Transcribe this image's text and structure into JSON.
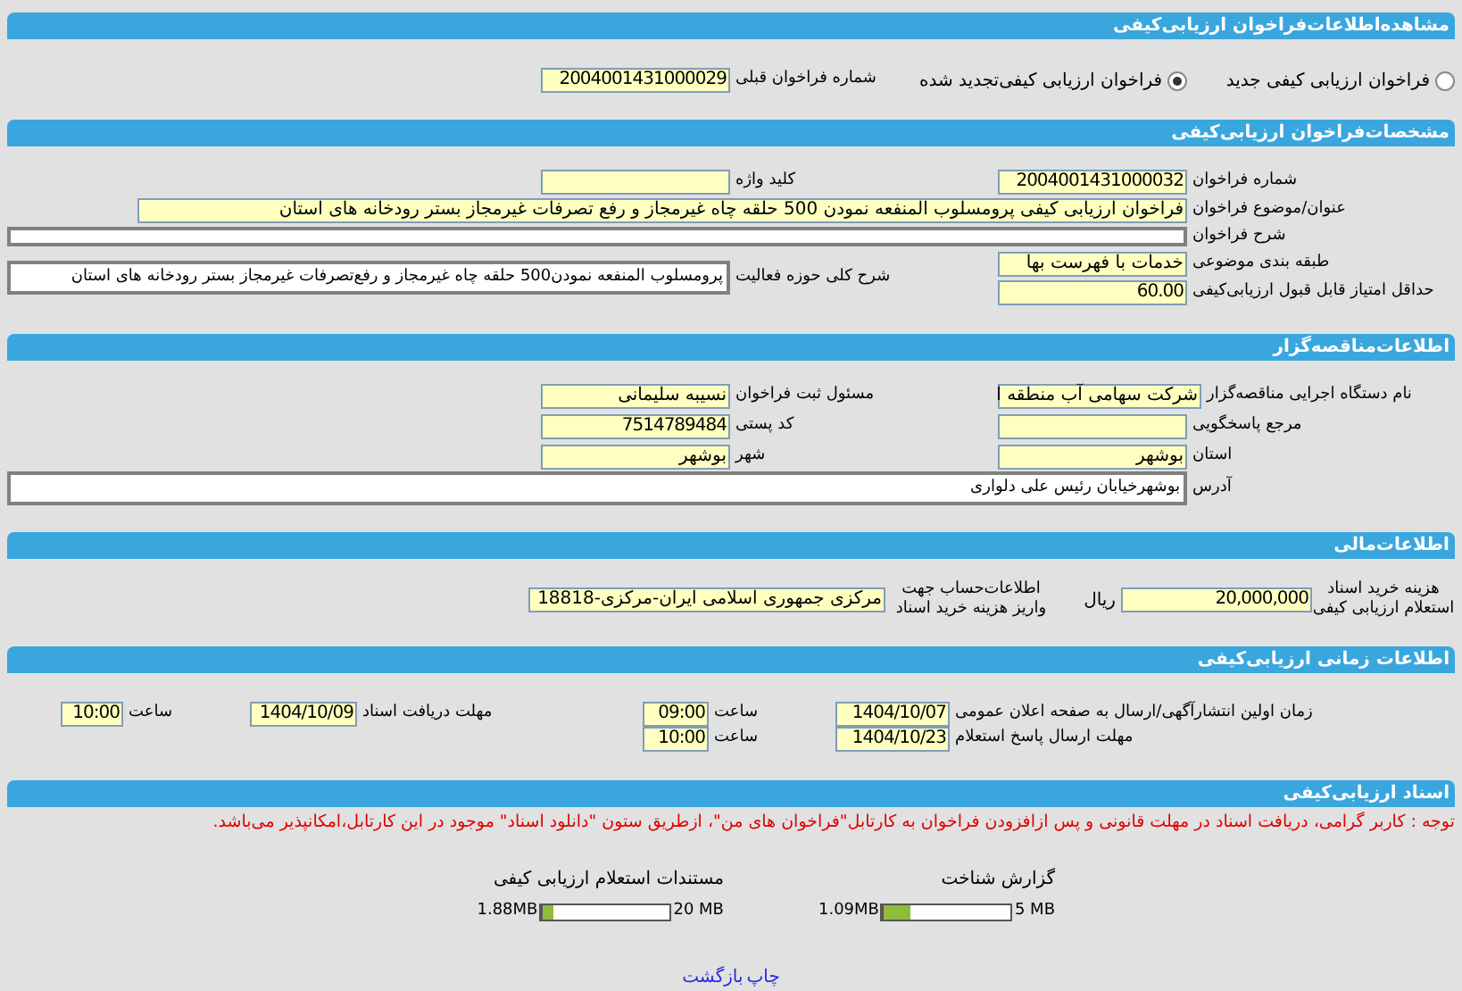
{
  "page_title": "مشاهده‌اطلاعات‌فراخوان ارزیابی‌کیفی",
  "call_type": {
    "options": [
      {
        "label": "فراخوان ارزیابی کیفی جدید",
        "selected": false
      },
      {
        "label": "فراخوان ارزیابی کیفی‌تجدید شده",
        "selected": true
      }
    ],
    "previous_number": {
      "label": "شماره فراخوان قبلی",
      "value": "2004001431000029"
    }
  },
  "specs": {
    "title": "مشخصات‌فراخوان ارزیابی‌کیفی",
    "number": {
      "label": "شماره فراخوان",
      "value": "2004001431000032"
    },
    "keyword": {
      "label": "کلید واژه"
    },
    "subject": {
      "label": "عنوان/موضوع فراخوان",
      "value": "فراخوان ارزیابی کیفی پرومسلوب المنفعه نمودن 500 حلقه چاه غیرمجاز و رفع تصرفات غیرمجاز بستر رودخانه های استان"
    },
    "description": {
      "label": "شرح فراخوان"
    },
    "category": {
      "label": "طبقه بندی موضوعی",
      "value": "خدمات با فهرست بها"
    },
    "min_score": {
      "label": "حداقل امتیاز قابل قبول ارزیابی‌کیفی",
      "value": "60.00"
    },
    "activity": {
      "label": "شرح کلی حوزه فعالیت",
      "value": "پرومسلوب المنفعه نمودن500 حلقه چاه غیرمجاز و رفع‌تصرفات غیرمجاز بستر رودخانه های استان"
    }
  },
  "organizer": {
    "title": "اطلاعات‌مناقصه‌گزار",
    "organization": {
      "label": "نام دستگاه اجرایی مناقصه‌گزار",
      "value": "شرکت سهامی آب منطقه ا"
    },
    "registrar": {
      "label": "مسئول ثبت فراخوان",
      "value": "نسیبه سلیمانی"
    },
    "responder": {
      "label": "مرجع پاسخگویی"
    },
    "postal_code": {
      "label": "کد پستی",
      "value": "7514789484"
    },
    "province": {
      "label": "استان",
      "value": "بوشهر"
    },
    "city": {
      "label": "شهر",
      "value": "بوشهر"
    },
    "address": {
      "label": "آدرس",
      "value": "بوشهرخیابان رئیس علی دلواری"
    }
  },
  "financial": {
    "title": "اطلاعات‌مالی",
    "fee": {
      "label_lines": [
        "هزینه خرید اسناد",
        "استعلام ارزیابی کیفی"
      ],
      "value": "20,000,000",
      "unit": "ریال"
    },
    "account": {
      "label_lines": [
        "اطلاعات‌حساب جهت",
        "واریز هزینه خرید اسناد"
      ],
      "value": "مرکزی جمهوری اسلامی ایران-مرکزی-18818"
    }
  },
  "timing": {
    "title": "اطلاعات زمانی ارزیابی‌کیفی",
    "rows": [
      {
        "label": "زمان اولین انتشارآگهی/ارسال به صفحه اعلان عمومی",
        "date": "1404/10/07",
        "time_label": "ساعت",
        "time": "09:00",
        "second": {
          "label": "مهلت دریافت اسناد",
          "date": "1404/10/09",
          "time_label": "ساعت",
          "time": "10:00"
        }
      },
      {
        "label": "مهلت ارسال پاسخ استعلام",
        "date": "1404/10/23",
        "time_label": "ساعت",
        "time": "10:00"
      }
    ]
  },
  "documents": {
    "title": "اسناد ارزیابی‌کیفی",
    "note": "توجه : کاربر گرامی، دریافت اسناد در مهلت قانونی و پس ازافزودن فراخوان به کارتابل\"فراخوان های من\"، ازطریق ستون \"دانلود اسناد\" موجود در این کارتابل،امکانپذیر می‌باشد.",
    "files": [
      {
        "title": "گزارش شناخت",
        "max": "5 MB",
        "size": "1.09MB",
        "level": 0.22
      },
      {
        "title": "مستندات استعلام ارزیابی کیفی",
        "max": "20 MB",
        "size": "1.88MB",
        "level": 0.094
      }
    ]
  },
  "links": [
    "چاپ",
    "بازگشت"
  ]
}
